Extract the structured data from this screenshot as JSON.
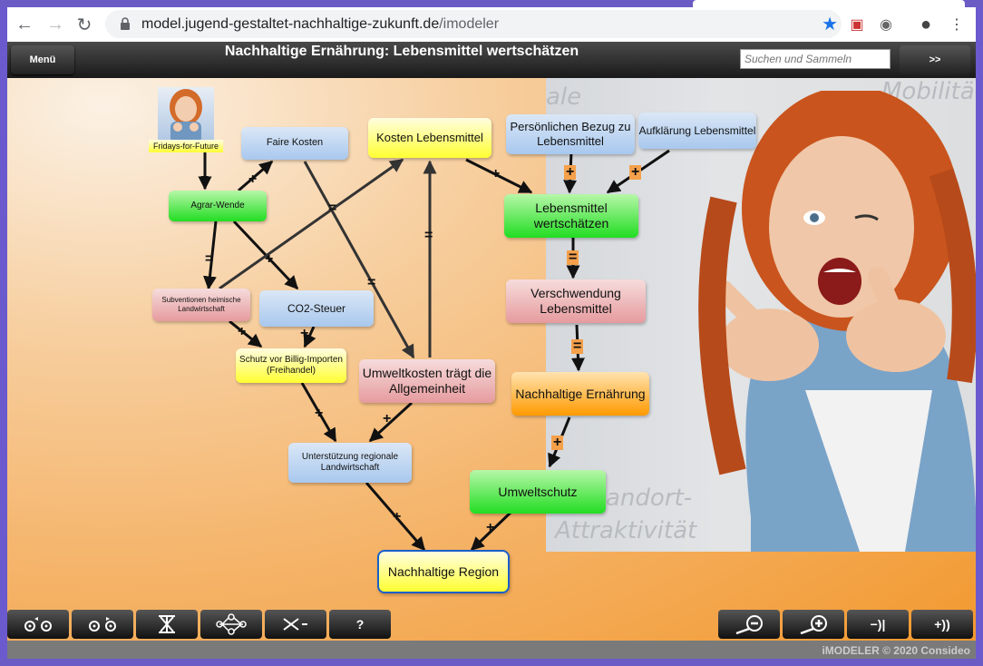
{
  "browser": {
    "url_host": "model.jugend-gestaltet-nachhaltige-zukunft.de",
    "url_path": "/imodeler"
  },
  "app": {
    "menu_label": "Menü",
    "title": "Nachhaltige Ernährung: Lebensmittel wertschätzen",
    "search_placeholder": "Suchen und Sammeln",
    "next_label": ">>",
    "copyright": "iMODELER © 2020 Consideo"
  },
  "background_words": [
    "Mobilität",
    "ale",
    "andort-",
    "Attraktivität"
  ],
  "nodes": {
    "fridays": "Fridays-for-Future",
    "faire_kosten": "Faire Kosten",
    "kosten_lebensmittel": "Kosten Lebensmittel",
    "persoenlicher_bezug": "Persönlichen Bezug zu Lebensmittel",
    "aufklaerung": "Aufklärung Lebensmittel",
    "agrar_wende": "Agrar-Wende",
    "lebensmittel_wertschaetzen": "Lebensmittel wertschätzen",
    "subventionen": "Subventionen heimische Landwirtschaft",
    "co2_steuer": "CO2-Steuer",
    "verschwendung": "Verschwendung Lebensmittel",
    "schutz": "Schutz vor Billig-Importen (Freihandel)",
    "umweltkosten": "Umweltkosten trägt die Allgemeinheit",
    "nachhaltige_ernaehrung": "Nachhaltige Ernährung",
    "unterstuetzung": "Unterstützung regionale Landwirtschaft",
    "umweltschutz": "Umweltschutz",
    "nachhaltige_region": "Nachhaltige Region"
  },
  "bottom_toolbar": {
    "help_label": "?",
    "zoom_fit_out": "−)|",
    "zoom_fit_in": "+))"
  }
}
